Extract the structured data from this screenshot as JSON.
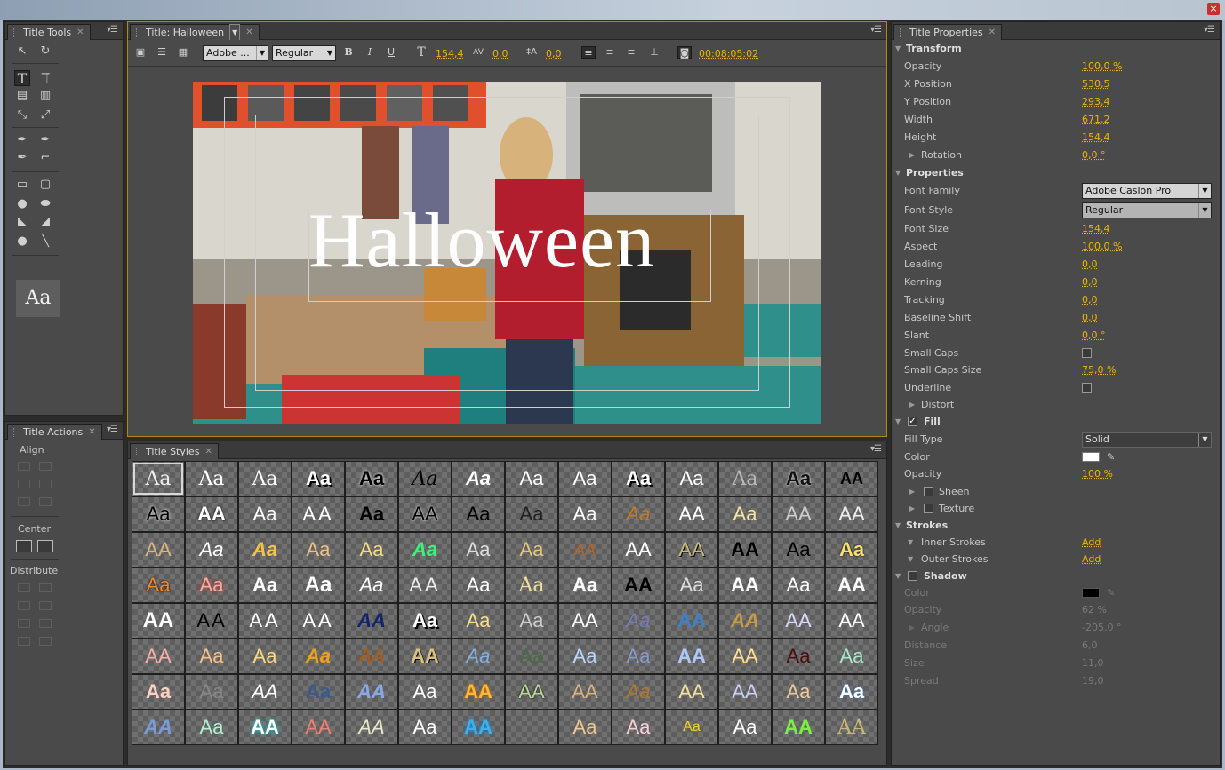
{
  "window": {
    "close_glyph": "×"
  },
  "title_tools": {
    "tab": "Title Tools",
    "preview_text": "Aa"
  },
  "title_actions": {
    "tab": "Title Actions",
    "align_label": "Align",
    "center_label": "Center",
    "distribute_label": "Distribute"
  },
  "designer": {
    "tab": "Title: Halloween",
    "font_family": "Adobe ...",
    "font_style": "Regular",
    "bold": "B",
    "italic": "I",
    "underline": "U",
    "font_size": "154,4",
    "kerning": "0,0",
    "leading": "0,0",
    "timecode": "00:08:05:02",
    "title_text": "Halloween"
  },
  "title_styles": {
    "tab": "Title Styles",
    "swatch_text": "Aa",
    "row1": [
      "Aa",
      "Aa",
      "Aa",
      "Aa",
      "Aa",
      "Aa",
      "Aa",
      "Aa",
      "Aa",
      "Aa",
      "Aa",
      "Aa",
      "Aa",
      "AA"
    ],
    "row2": [
      "Aa",
      "AA",
      "Aa",
      "AA",
      "Aa",
      "AA",
      "Aa",
      "Aa",
      "Aa",
      "Aa",
      "AA",
      "Aa",
      "AA",
      "AA"
    ],
    "row3": [
      "AA",
      "Aa",
      "Aa",
      "Aa",
      "Aa",
      "Aa",
      "Aa",
      "Aa",
      "AA",
      "AA",
      "AA",
      "AA",
      "Aa",
      "Aa"
    ],
    "row4": [
      "Aa",
      "Aa",
      "Aa",
      "Aa",
      "Aa",
      "AA",
      "Aa",
      "Aa",
      "Aa",
      "AA",
      "Aa",
      "AA",
      "Aa",
      "AA"
    ],
    "row5": [
      "AA",
      "AA",
      "AA",
      "AA",
      "AA",
      "Aa",
      "Aa",
      "Aa",
      "AA",
      "Aa",
      "AA",
      "AA",
      "AA",
      "AA"
    ],
    "row6": [
      "AA",
      "Aa",
      "Aa",
      "Aa",
      "AA",
      "AA",
      "Aa",
      "Aa",
      "Aa",
      "Aa",
      "AA",
      "AA",
      "Aa",
      "Aa"
    ],
    "row7": [
      "Aa",
      "Aa",
      "AA",
      "Aa",
      "AA",
      "Aa",
      "AA",
      "AA",
      "AA",
      "Aa",
      "AA",
      "AA",
      "Aa",
      "Aa"
    ],
    "row8": [
      "AA",
      "Aa",
      "AA",
      "AA",
      "AA",
      "Aa",
      "AA",
      "",
      "Aa",
      "Aa",
      "Aa",
      "Aa",
      "AA",
      "AA"
    ]
  },
  "title_properties": {
    "tab": "Title Properties",
    "transform_head": "Transform",
    "opacity_label": "Opacity",
    "opacity_val": "100,0 %",
    "x_label": "X Position",
    "x_val": "530,5",
    "y_label": "Y Position",
    "y_val": "293,4",
    "width_label": "Width",
    "width_val": "671,2",
    "height_label": "Height",
    "height_val": "154,4",
    "rotation_label": "Rotation",
    "rotation_val": "0,0 °",
    "properties_head": "Properties",
    "font_family_label": "Font Family",
    "font_family_val": "Adobe Caslon Pro",
    "font_style_label": "Font Style",
    "font_style_val": "Regular",
    "font_size_label": "Font Size",
    "font_size_val": "154,4",
    "aspect_label": "Aspect",
    "aspect_val": "100,0 %",
    "leading_label": "Leading",
    "leading_val": "0,0",
    "kerning_label": "Kerning",
    "kerning_val": "0,0",
    "tracking_label": "Tracking",
    "tracking_val": "0,0",
    "baseline_label": "Baseline Shift",
    "baseline_val": "0,0",
    "slant_label": "Slant",
    "slant_val": "0,0 °",
    "smallcaps_label": "Small Caps",
    "smallcaps_size_label": "Small Caps Size",
    "smallcaps_size_val": "75,0 %",
    "underline_label": "Underline",
    "distort_label": "Distort",
    "fill_head": "Fill",
    "fill_type_label": "Fill Type",
    "fill_type_val": "Solid",
    "color_label": "Color",
    "fill_opacity_label": "Opacity",
    "fill_opacity_val": "100 %",
    "sheen_label": "Sheen",
    "texture_label": "Texture",
    "strokes_head": "Strokes",
    "inner_label": "Inner Strokes",
    "inner_add": "Add",
    "outer_label": "Outer Strokes",
    "outer_add": "Add",
    "shadow_head": "Shadow",
    "shadow_color_label": "Color",
    "shadow_opacity_label": "Opacity",
    "shadow_opacity_val": "62 %",
    "shadow_angle_label": "Angle",
    "shadow_angle_val": "-205,0 °",
    "shadow_distance_label": "Distance",
    "shadow_distance_val": "6,0",
    "shadow_size_label": "Size",
    "shadow_size_val": "11,0",
    "shadow_spread_label": "Spread",
    "shadow_spread_val": "19,0"
  },
  "colors": {
    "accent": "#f0b400",
    "fill_color": "#ffffff",
    "shadow_color": "#000000",
    "panel": "#4a4a4a"
  }
}
